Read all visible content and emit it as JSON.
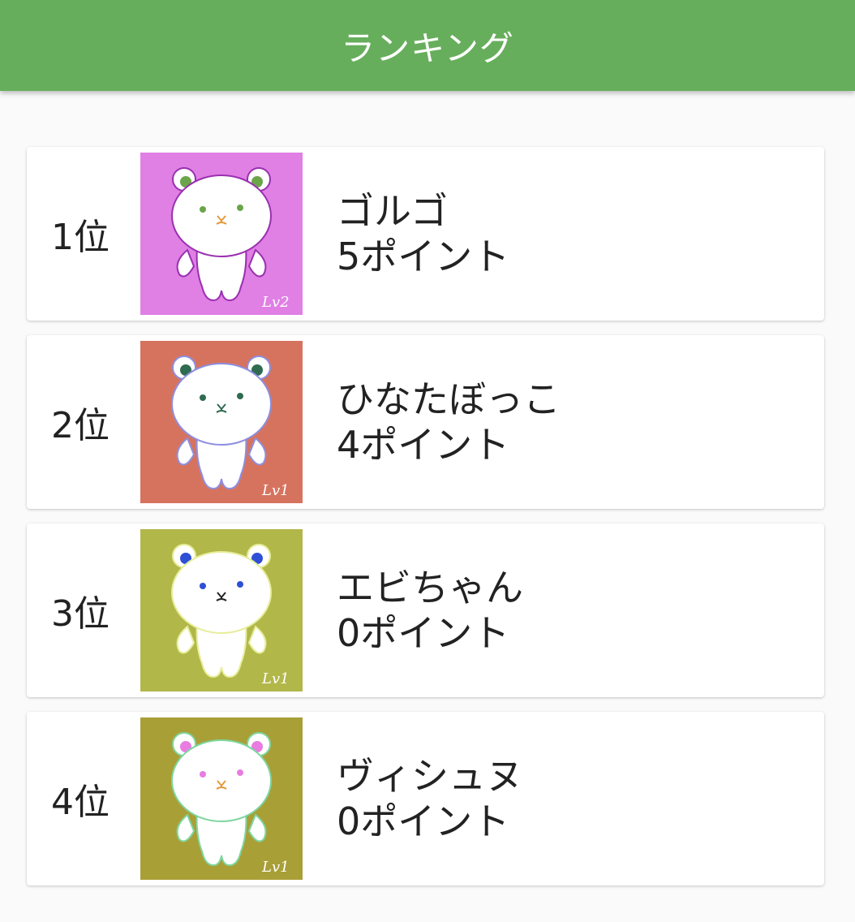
{
  "appbar": {
    "title": "ランキング"
  },
  "rankings": [
    {
      "rank": "1位",
      "name": "ゴルゴ",
      "points": "5ポイント",
      "level": "Lv2",
      "bg": "#e07fe4",
      "outline": "#9a2fb0",
      "ear": "#6aa54a",
      "eye": "#6aa54a",
      "mouth": "#e39a3b"
    },
    {
      "rank": "2位",
      "name": "ひなたぼっこ",
      "points": "4ポイント",
      "level": "Lv1",
      "bg": "#d6735f",
      "outline": "#8e8fe0",
      "ear": "#2f6b50",
      "eye": "#2f6b50",
      "mouth": "#2f6b50"
    },
    {
      "rank": "3位",
      "name": "エビちゃん",
      "points": "0ポイント",
      "level": "Lv1",
      "bg": "#b2b74a",
      "outline": "#e6ee9a",
      "ear": "#2e4fd6",
      "eye": "#2e4fd6",
      "mouth": "#222222"
    },
    {
      "rank": "4位",
      "name": "ヴィシュヌ",
      "points": "0ポイント",
      "level": "Lv1",
      "bg": "#a99f37",
      "outline": "#7fd6a0",
      "ear": "#e87ce0",
      "eye": "#e87ce0",
      "mouth": "#e39a3b"
    }
  ]
}
